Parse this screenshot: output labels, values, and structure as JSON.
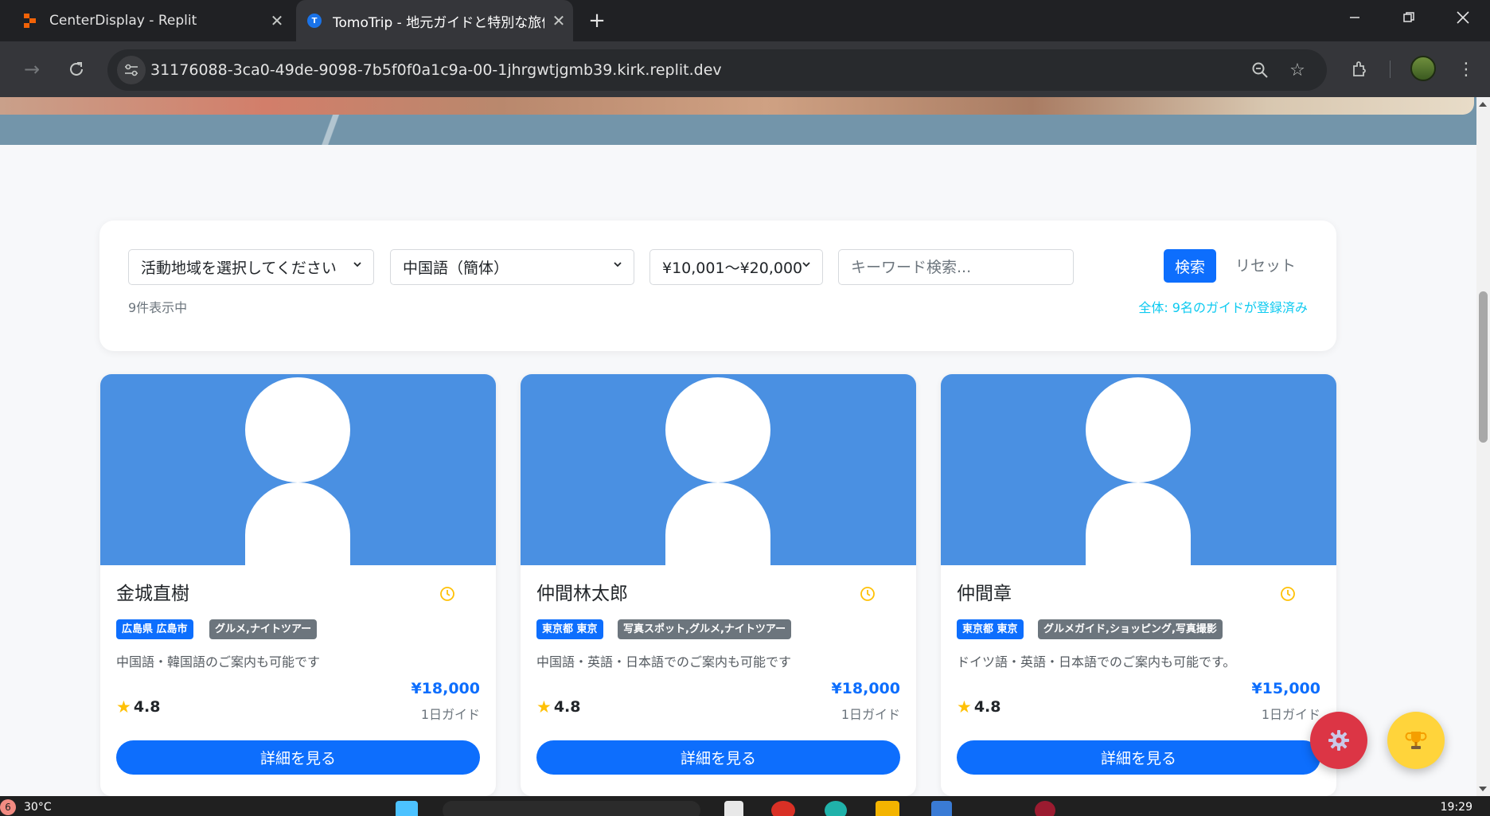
{
  "browser": {
    "tabs": [
      {
        "title": "CenterDisplay - Replit",
        "favicon": "replit-icon"
      },
      {
        "title": "TomoTrip - 地元ガイドと特別な旅体験",
        "favicon": "tomotrip-icon",
        "favicon_letter": "T"
      }
    ],
    "url": "31176088-3ca0-49de-9098-7b5f0f0a1c9a-00-1jhrgwtjgmb39.kirk.replit.dev"
  },
  "filters": {
    "region": "活動地域を選択してください",
    "language": "中国語（簡体）",
    "price": "¥10,001〜¥20,000",
    "keyword_placeholder": "キーワード検索...",
    "search_label": "検索",
    "reset_label": "リセット",
    "count_text": "9件表示中",
    "total_text": "全体: 9名のガイドが登録済み"
  },
  "guides": [
    {
      "name": "金城直樹",
      "region": "広島県 広島市",
      "specialty": "グルメ,ナイトツアー",
      "description": "中国語・韓国語のご案内も可能です",
      "rating": "4.8",
      "price": "¥18,000",
      "price_unit": "1日ガイド",
      "button": "詳細を見る"
    },
    {
      "name": "仲間林太郎",
      "region": "東京都 東京",
      "specialty": "写真スポット,グルメ,ナイトツアー",
      "description": "中国語・英語・日本語でのご案内も可能です",
      "rating": "4.8",
      "price": "¥18,000",
      "price_unit": "1日ガイド",
      "button": "詳細を見る"
    },
    {
      "name": "仲間章",
      "region": "東京都 東京",
      "specialty": "グルメガイド,ショッピング,写真撮影",
      "description": "ドイツ語・英語・日本語でのご案内も可能です。",
      "rating": "4.8",
      "price": "¥15,000",
      "price_unit": "1日ガイド",
      "button": "詳細を見る"
    }
  ],
  "taskbar": {
    "weather_badge": "6",
    "temperature": "30°C",
    "time": "19:29"
  },
  "colors": {
    "primary": "#0d6efd",
    "card_photo": "#4a90e2",
    "secondary": "#6c757d",
    "info": "#0dcaf0",
    "star": "#ffc107",
    "fab_settings": "#dc3545",
    "fab_trophy": "#ffd43b"
  },
  "icons": {
    "region_chevron": "chevron-down-icon",
    "availability": "clock-icon",
    "rating": "star-icon",
    "fab_settings": "gear-icon",
    "fab_trophy": "trophy-icon"
  }
}
